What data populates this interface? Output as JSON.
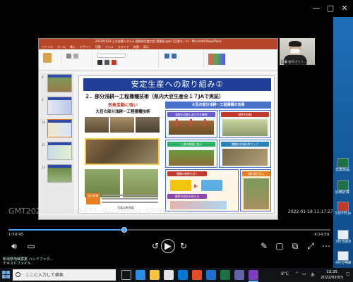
{
  "player": {
    "recording_filename": "GMT20220119-001431_Recording_1920x1040",
    "overlay_timestamp": "2022-01-19  11:17:27",
    "elapsed": "1:50:45",
    "remaining": "4:14:59",
    "progress_fraction": 0.36,
    "accent_color": "#4aa3ff"
  },
  "ppt": {
    "window_title": "202201019 土木金属システム 植物体生産工程 実業化.pptx [互換モード] - Microsoft PowerPoint",
    "tabs": [
      "ファイル",
      "ホーム",
      "挿入",
      "デザイン",
      "切替",
      "アニメ",
      "スライド",
      "校閲",
      "表示"
    ],
    "slide_numbers": [
      "8",
      "9",
      "10",
      "11",
      "12"
    ],
    "selected_slide": 2
  },
  "slide": {
    "title": "安定生産への取り組み①",
    "subtitle": "２．部分浅耕一工程播種技術（県内大豆生産全１７JAで実証）",
    "left_heading_1": "気象変動に強い",
    "left_heading_2": "大豆の部分浅耕一工程播種技術",
    "tag_label": "培土作業",
    "right_heading": "大豆の部分浅耕一工程播種の効果",
    "right_labels": [
      "湿害を回避し苗立ちを確保",
      "雑草を抑制",
      "土壌の乾燥に強い",
      "播種の作業効率アップ",
      "播種の晩期を防ぐ",
      "雑草の発生を抑える",
      "晴れ間が多い"
    ],
    "footer_note": "写真は新潟県"
  },
  "webcam": {
    "name": "佐藤 信行(さとう..."
  },
  "desktop": {
    "icons": [
      "営業部品.xlsx",
      "原価計算.xlsx",
      "5月3日.pdf",
      "3月分請求",
      "4月分明細"
    ],
    "bottom_left_text": "新潟県地域農業 ハンドブック...\nテキストファイル"
  },
  "taskbar": {
    "search_placeholder": "ここに入力して検索",
    "temperature": "8°C",
    "ime": "あ",
    "time": "13:35",
    "date": "2022/02/03"
  }
}
